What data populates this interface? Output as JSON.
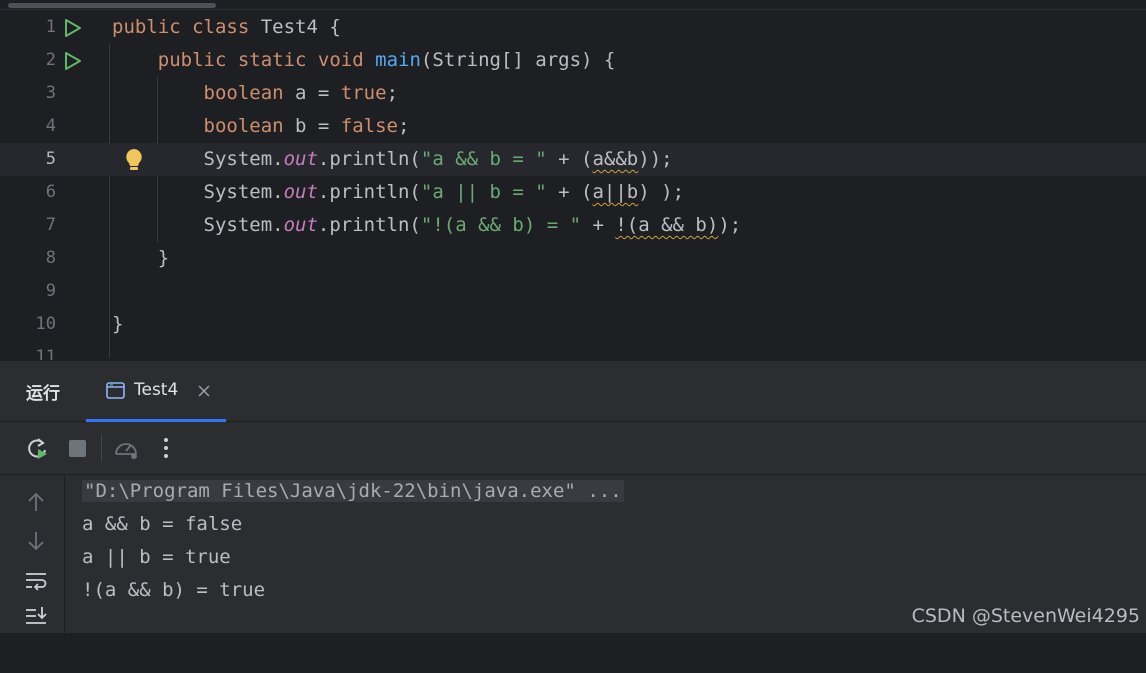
{
  "editor": {
    "lines": [
      {
        "num": "1",
        "parts": [
          {
            "t": "public ",
            "c": "kw"
          },
          {
            "t": "class ",
            "c": "kw"
          },
          {
            "t": "Test4 {",
            "c": ""
          }
        ]
      },
      {
        "num": "2",
        "parts": [
          {
            "t": "    public ",
            "c": "kw"
          },
          {
            "t": "static ",
            "c": "kw"
          },
          {
            "t": "void ",
            "c": "kw"
          },
          {
            "t": "main",
            "c": "fn"
          },
          {
            "t": "(String[] args) {",
            "c": ""
          }
        ]
      },
      {
        "num": "3",
        "parts": [
          {
            "t": "        boolean ",
            "c": "kw"
          },
          {
            "t": "a = ",
            "c": ""
          },
          {
            "t": "true",
            "c": "kw"
          },
          {
            "t": ";",
            "c": ""
          }
        ]
      },
      {
        "num": "4",
        "parts": [
          {
            "t": "        boolean ",
            "c": "kw"
          },
          {
            "t": "b = ",
            "c": ""
          },
          {
            "t": "false",
            "c": "kw"
          },
          {
            "t": ";",
            "c": ""
          }
        ]
      },
      {
        "num": "5",
        "parts": [
          {
            "t": "        System.",
            "c": ""
          },
          {
            "t": "out",
            "c": "fld"
          },
          {
            "t": ".println(",
            "c": ""
          },
          {
            "t": "\"a && b = \"",
            "c": "str"
          },
          {
            "t": " + (",
            "c": ""
          },
          {
            "t": "a&&b",
            "c": "warn"
          },
          {
            "t": "));",
            "c": ""
          }
        ]
      },
      {
        "num": "6",
        "parts": [
          {
            "t": "        System.",
            "c": ""
          },
          {
            "t": "out",
            "c": "fld"
          },
          {
            "t": ".println(",
            "c": ""
          },
          {
            "t": "\"a || b = \"",
            "c": "str"
          },
          {
            "t": " + (",
            "c": ""
          },
          {
            "t": "a||b",
            "c": "warn"
          },
          {
            "t": ") );",
            "c": ""
          }
        ]
      },
      {
        "num": "7",
        "parts": [
          {
            "t": "        System.",
            "c": ""
          },
          {
            "t": "out",
            "c": "fld"
          },
          {
            "t": ".println(",
            "c": ""
          },
          {
            "t": "\"!(a && b) = \"",
            "c": "str"
          },
          {
            "t": " + ",
            "c": ""
          },
          {
            "t": "!(a && b)",
            "c": "warn"
          },
          {
            "t": ");",
            "c": ""
          }
        ]
      },
      {
        "num": "8",
        "parts": [
          {
            "t": "    }",
            "c": ""
          }
        ]
      },
      {
        "num": "9",
        "parts": []
      },
      {
        "num": "10",
        "parts": [
          {
            "t": "}",
            "c": ""
          }
        ]
      },
      {
        "num": "11",
        "parts": []
      }
    ],
    "current_line": "5"
  },
  "run_panel": {
    "title": "运行",
    "tab_label": "Test4",
    "console_lines": [
      "\"D:\\Program Files\\Java\\jdk-22\\bin\\java.exe\" ...",
      "a && b = false",
      "a || b = true",
      "!(a && b) = true"
    ]
  },
  "watermark": "CSDN @StevenWei4295"
}
